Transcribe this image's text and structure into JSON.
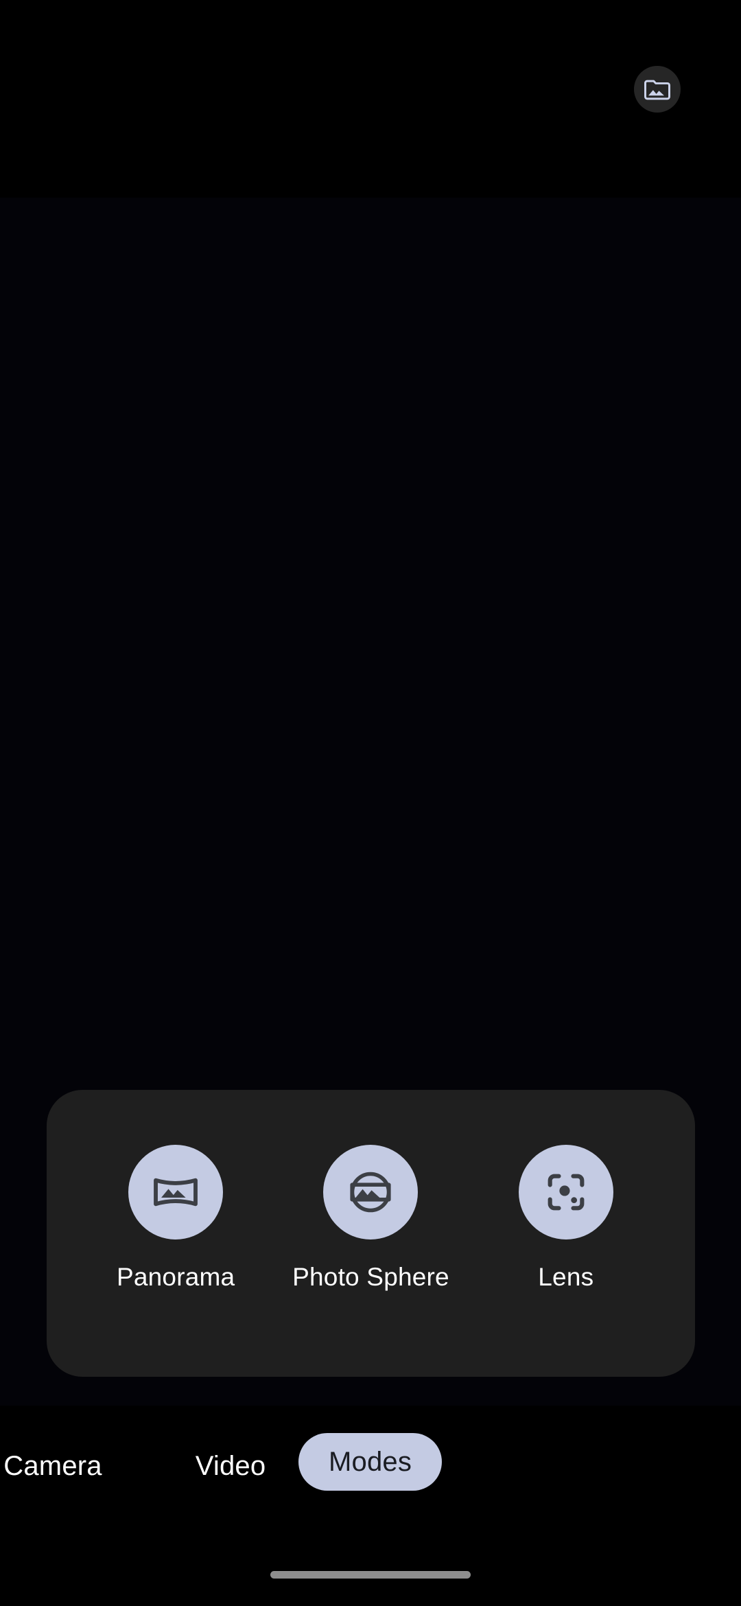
{
  "app": {
    "name": "Camera",
    "screen": "Modes"
  },
  "colors": {
    "background": "#000000",
    "viewfinder": "#030308",
    "panel_bg": "#1f1f1f",
    "accent_light": "#c4cbe3",
    "icon_dark": "#3c3f45",
    "gallery_button_bg": "#262626",
    "label_text": "#ffffff",
    "active_tab_text": "#1a1c22",
    "home_indicator": "#8e8e8e"
  },
  "top_bar": {
    "gallery_button": {
      "label": "Gallery",
      "icon": "folder-image-icon"
    }
  },
  "viewfinder": {
    "state": "black-preview"
  },
  "modes_panel": {
    "items": [
      {
        "label": "Panorama",
        "icon": "panorama-icon"
      },
      {
        "label": "Photo Sphere",
        "icon": "photo-sphere-icon"
      },
      {
        "label": "Lens",
        "icon": "lens-scan-icon"
      }
    ]
  },
  "tab_bar": {
    "tabs": [
      {
        "label": "Camera",
        "selected": false
      },
      {
        "label": "Video",
        "selected": false
      },
      {
        "label": "Modes",
        "selected": true
      }
    ]
  },
  "navigation": {
    "home_indicator": "home-gesture-bar"
  }
}
